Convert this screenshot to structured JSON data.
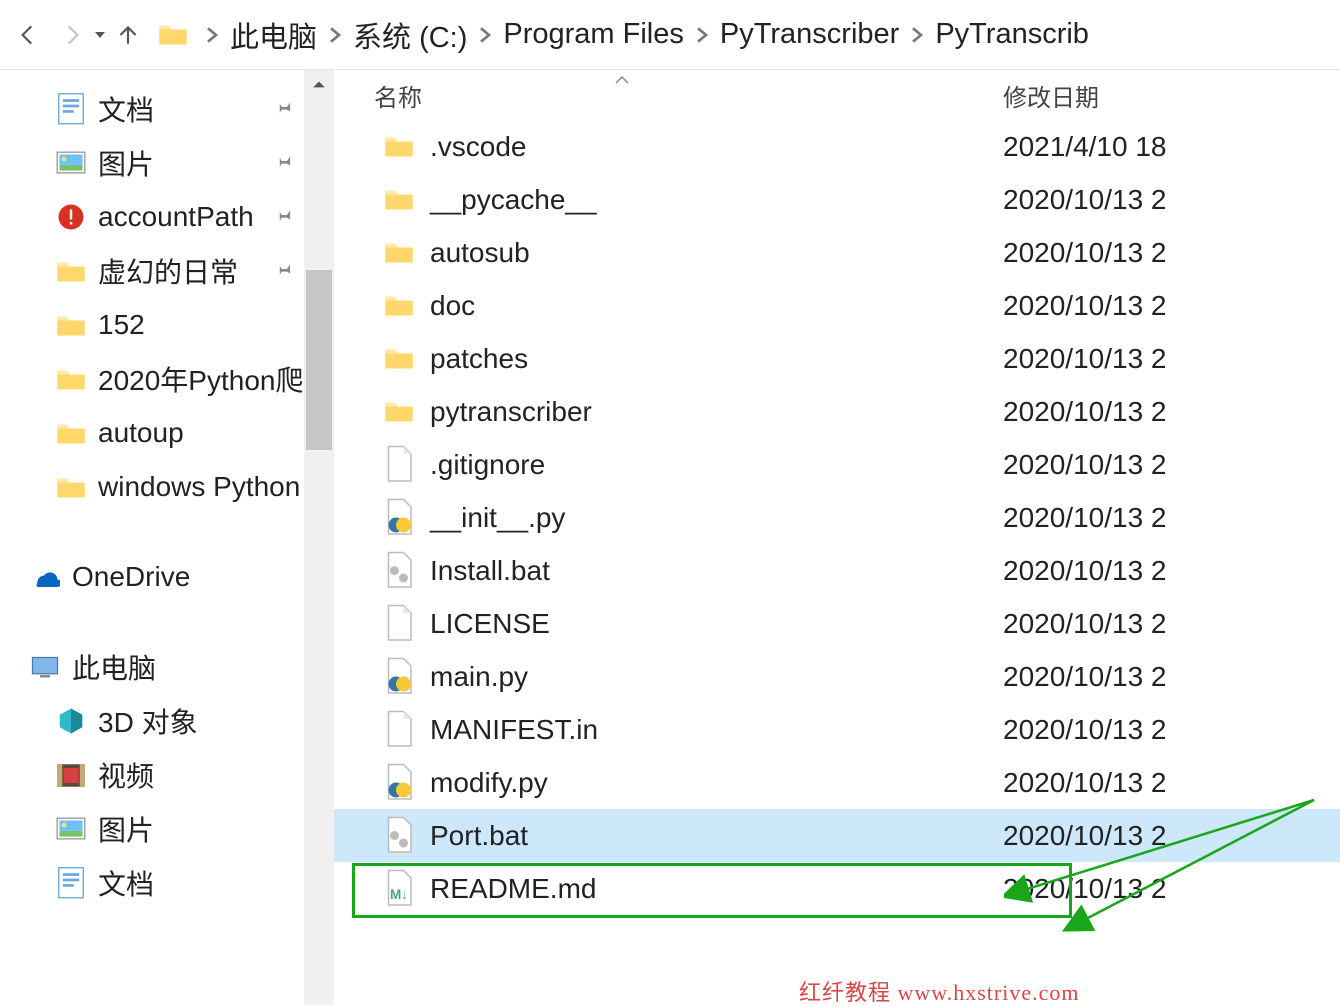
{
  "breadcrumb": [
    "此电脑",
    "系统 (C:)",
    "Program Files",
    "PyTranscriber",
    "PyTranscrib"
  ],
  "sidebar": {
    "items": [
      {
        "label": "文档",
        "icon": "doc",
        "pinned": true
      },
      {
        "label": "图片",
        "icon": "pic",
        "pinned": true
      },
      {
        "label": "accountPath",
        "icon": "alert-folder",
        "pinned": true
      },
      {
        "label": "虚幻的日常",
        "icon": "folder",
        "pinned": true
      },
      {
        "label": "152",
        "icon": "folder",
        "pinned": false
      },
      {
        "label": "2020年Python爬",
        "icon": "folder",
        "pinned": false
      },
      {
        "label": "autoup",
        "icon": "folder",
        "pinned": false
      },
      {
        "label": "windows Python",
        "icon": "folder",
        "pinned": false
      }
    ],
    "onedrive": "OneDrive",
    "thispc": "此电脑",
    "pcitems": [
      {
        "label": "3D 对象",
        "icon": "3d"
      },
      {
        "label": "视频",
        "icon": "video"
      },
      {
        "label": "图片",
        "icon": "pic"
      },
      {
        "label": "文档",
        "icon": "doc"
      }
    ]
  },
  "columns": {
    "name": "名称",
    "date": "修改日期"
  },
  "files": [
    {
      "name": ".vscode",
      "icon": "folder",
      "date": "2021/4/10 18"
    },
    {
      "name": "__pycache__",
      "icon": "folder",
      "date": "2020/10/13 2"
    },
    {
      "name": "autosub",
      "icon": "folder",
      "date": "2020/10/13 2"
    },
    {
      "name": "doc",
      "icon": "folder",
      "date": "2020/10/13 2"
    },
    {
      "name": "patches",
      "icon": "folder",
      "date": "2020/10/13 2"
    },
    {
      "name": "pytranscriber",
      "icon": "folder",
      "date": "2020/10/13 2"
    },
    {
      "name": ".gitignore",
      "icon": "file",
      "date": "2020/10/13 2"
    },
    {
      "name": "__init__.py",
      "icon": "py",
      "date": "2020/10/13 2"
    },
    {
      "name": "Install.bat",
      "icon": "bat",
      "date": "2020/10/13 2"
    },
    {
      "name": "LICENSE",
      "icon": "file",
      "date": "2020/10/13 2"
    },
    {
      "name": "main.py",
      "icon": "py",
      "date": "2020/10/13 2"
    },
    {
      "name": "MANIFEST.in",
      "icon": "file",
      "date": "2020/10/13 2"
    },
    {
      "name": "modify.py",
      "icon": "py",
      "date": "2020/10/13 2"
    },
    {
      "name": "Port.bat",
      "icon": "bat",
      "date": "2020/10/13 2",
      "selected": true
    },
    {
      "name": "README.md",
      "icon": "md",
      "date": "2020/10/13 2"
    }
  ],
  "watermark": "红纤教程 www.hxstrive.com"
}
